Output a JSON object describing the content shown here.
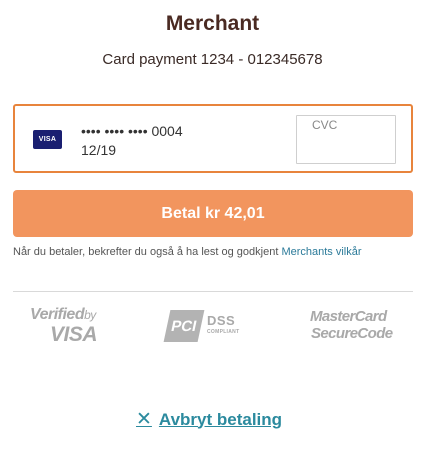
{
  "header": {
    "merchant_name": "Merchant",
    "payment_description": "Card payment 1234 - 012345678"
  },
  "card": {
    "brand_icon": "visa-card-icon",
    "brand_label": "VISA",
    "masked_number": "•••• •••• •••• 0004",
    "expiry": "12/19",
    "cvc_placeholder": "CVC",
    "border_color": "#e8843c"
  },
  "pay_button": {
    "label": "Betal kr 42,01",
    "color": "#f2955e"
  },
  "terms": {
    "text": "Når du betaler, bekrefter du også å ha lest og godkjent ",
    "link_label": "Merchants vilkår",
    "link_color": "#2b7a99"
  },
  "security_logos": {
    "verified_by_visa": {
      "line1": "Verified",
      "by": "by",
      "line2": "VISA"
    },
    "pci_dss": {
      "mark": "PCI",
      "label": "DSS",
      "sub": "COMPLIANT"
    },
    "mastercard_securecode": {
      "line1": "MasterCard",
      "line2": "SecureCode"
    }
  },
  "cancel": {
    "icon": "close-icon",
    "label": "Avbryt betaling",
    "color": "#2b8a9e"
  }
}
